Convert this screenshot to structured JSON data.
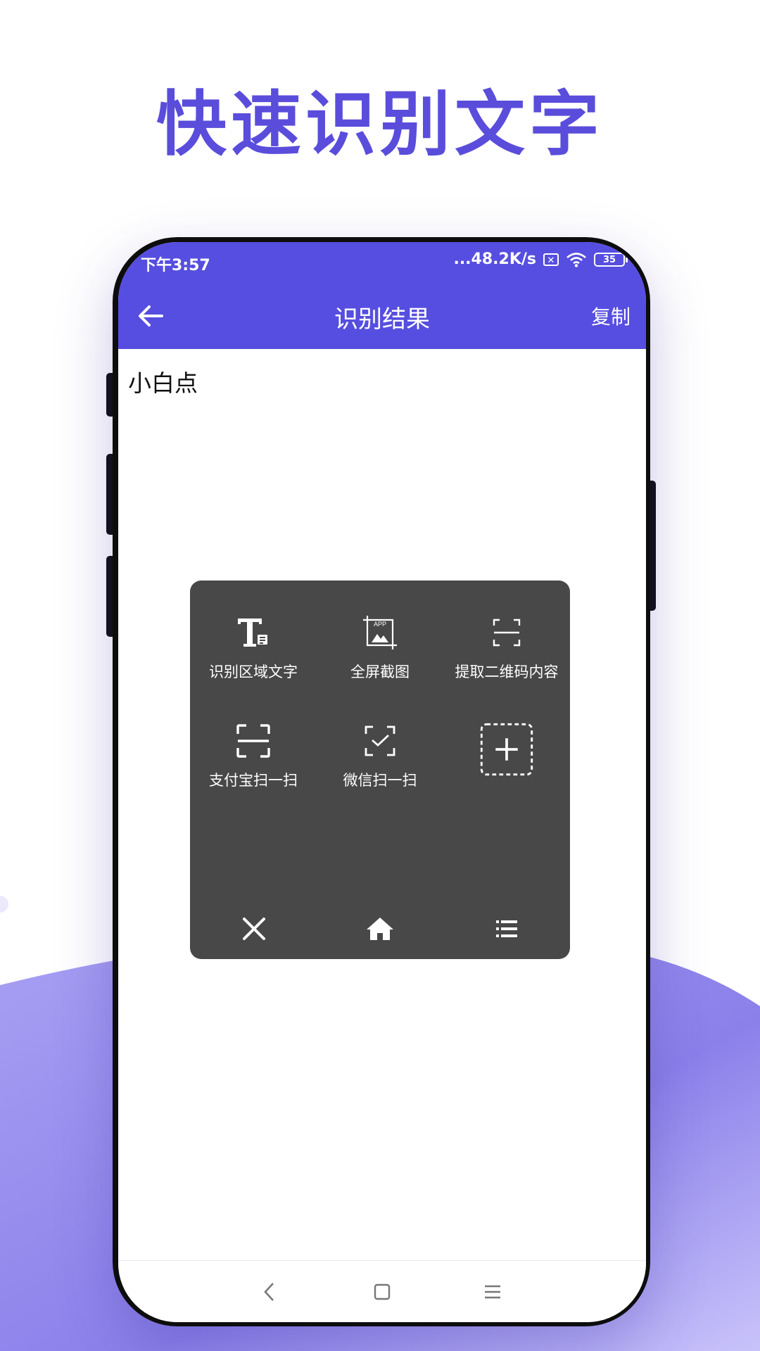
{
  "headline": {
    "text": "快速识别文字",
    "color": "#5a4ddb"
  },
  "status_bar": {
    "time": "下午3:57",
    "network_speed": "...48.2K/s",
    "battery_level": "35",
    "sim_icon": "sim-x-icon",
    "wifi_icon": "wifi-icon"
  },
  "app_bar": {
    "title": "识别结果",
    "copy_label": "复制",
    "back_icon": "arrow-left-icon",
    "background": "#564ee0"
  },
  "result": {
    "text": "小白点"
  },
  "floating_panel": {
    "items": [
      {
        "label": "识别区域文字",
        "icon": "text-recognition-icon"
      },
      {
        "label": "全屏截图",
        "icon": "app-screenshot-icon"
      },
      {
        "label": "提取二维码内容",
        "icon": "scan-frame-icon"
      },
      {
        "label": "支付宝扫一扫",
        "icon": "alipay-scan-icon"
      },
      {
        "label": "微信扫一扫",
        "icon": "wechat-scan-icon"
      },
      {
        "label": "",
        "icon": "add-icon"
      }
    ],
    "bottom": [
      {
        "icon": "close-icon"
      },
      {
        "icon": "home-icon"
      },
      {
        "icon": "menu-list-icon"
      }
    ],
    "background": "#484848"
  },
  "nav_bar": {
    "icons": [
      "back-triangle-icon",
      "home-square-icon",
      "recents-menu-icon"
    ]
  }
}
